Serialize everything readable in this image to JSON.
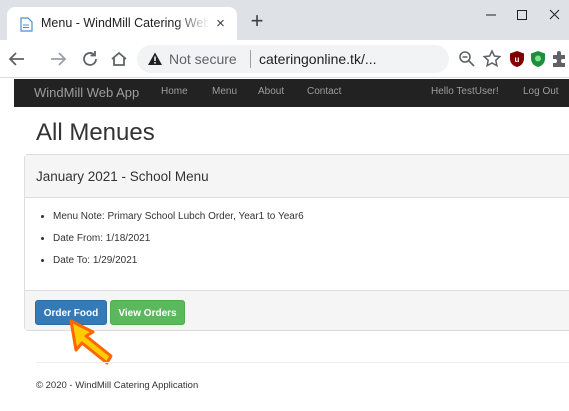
{
  "browser": {
    "tab_title": "Menu - WindMill Catering WebApp",
    "tab_close": "×",
    "new_tab": "+",
    "security_label": "Not secure",
    "url": "cateringonline.tk/..."
  },
  "navbar": {
    "brand": "WindMill Web App",
    "links": [
      "Home",
      "Menu",
      "About",
      "Contact"
    ],
    "greeting": "Hello TestUser!",
    "logout": "Log Out"
  },
  "page": {
    "title": "All Menues",
    "panel": {
      "heading": "January 2021 - School Menu",
      "details": [
        "Menu Note: Primary School Lubch Order, Year1 to Year6",
        "Date From: 1/18/2021",
        "Date To: 1/29/2021"
      ],
      "buttons": {
        "order": "Order Food",
        "view": "View Orders"
      }
    },
    "footer": "© 2020 - WindMill Catering Application"
  },
  "colors": {
    "navbar_bg": "#222222",
    "order_button": "#337ab7",
    "view_button": "#5cb85c",
    "cursor_fill": "#ffcc00",
    "cursor_stroke": "#ff6600"
  },
  "icons": [
    "document-favicon-icon",
    "close-icon",
    "plus-icon",
    "minimize-icon",
    "maximize-icon",
    "window-close-icon",
    "back-arrow-icon",
    "forward-arrow-icon",
    "reload-icon",
    "home-icon",
    "warning-triangle-icon",
    "zoom-icon",
    "bookmark-star-icon",
    "ublock-shield-icon",
    "shield-extension-icon",
    "puzzle-icon",
    "profile-avatar-icon",
    "kebab-menu-icon",
    "hand-cursor-icon"
  ]
}
